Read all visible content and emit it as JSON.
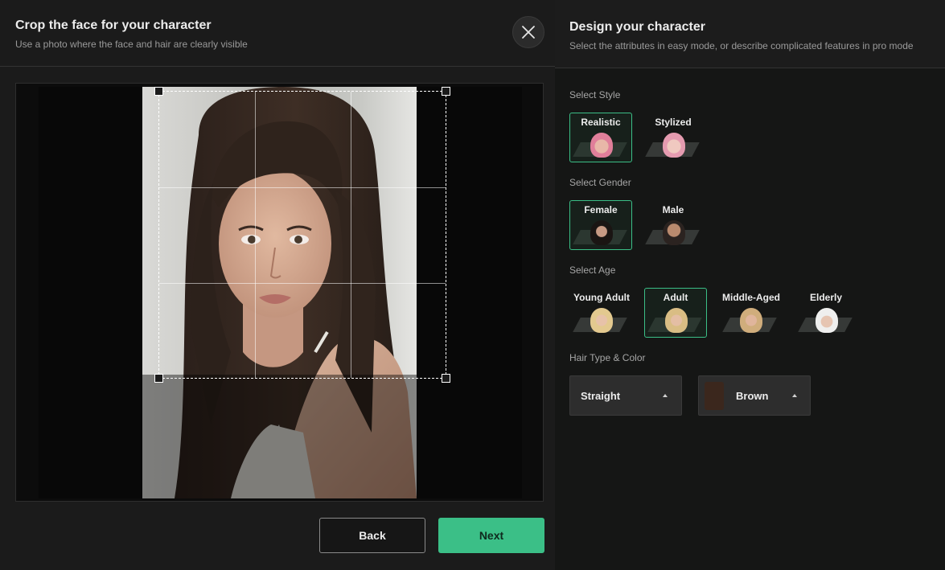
{
  "crop_modal": {
    "title": "Crop the face for your character",
    "subtitle": "Use a photo where the face and hair are clearly visible",
    "back_label": "Back",
    "next_label": "Next"
  },
  "design": {
    "title": "Design your character",
    "subtitle": "Select the attributes in easy mode, or describe complicated features in pro mode",
    "style": {
      "label": "Select Style",
      "options": [
        {
          "label": "Realistic",
          "selected": true
        },
        {
          "label": "Stylized",
          "selected": false
        }
      ]
    },
    "gender": {
      "label": "Select Gender",
      "options": [
        {
          "label": "Female",
          "selected": true
        },
        {
          "label": "Male",
          "selected": false
        }
      ]
    },
    "age": {
      "label": "Select Age",
      "options": [
        {
          "label": "Young Adult",
          "selected": false
        },
        {
          "label": "Adult",
          "selected": true
        },
        {
          "label": "Middle-Aged",
          "selected": false
        },
        {
          "label": "Elderly",
          "selected": false
        }
      ]
    },
    "hair": {
      "label": "Hair Type & Color",
      "type_value": "Straight",
      "color_value": "Brown",
      "color_swatch": "#3b271d"
    }
  },
  "colors": {
    "accent": "#3bbf87",
    "background": "#161616"
  }
}
